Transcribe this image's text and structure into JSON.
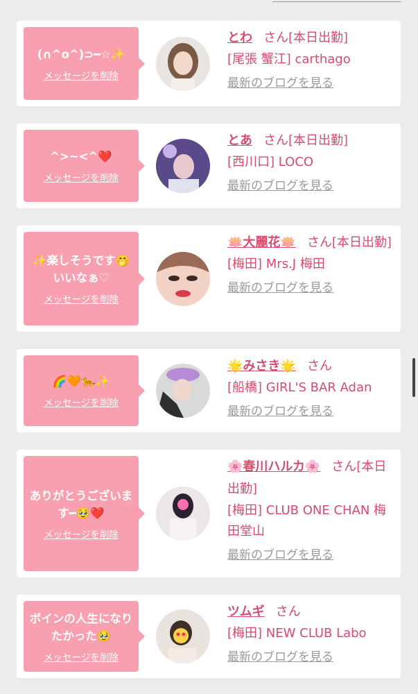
{
  "header": {
    "left_text": "",
    "right_link": ""
  },
  "cards": [
    {
      "message": "(∩^o^)⊃━☆✨",
      "delete_label": "メッセージを削除",
      "name": "とわ",
      "honorific": "さん",
      "status": "[本日出勤]",
      "shop": "[尾張 蟹江] carthago",
      "blog_link": "最新のブログを見る"
    },
    {
      "message": "^>~<^❤️",
      "delete_label": "メッセージを削除",
      "name": "とあ",
      "honorific": "さん",
      "status": "[本日出勤]",
      "shop": "[西川口] LOCO",
      "blog_link": "最新のブログを見る"
    },
    {
      "message": "✨楽しそうです🤭いいなぁ♡",
      "delete_label": "メッセージを削除",
      "name": "🪷大麗花🪷",
      "honorific": "さん",
      "status": "[本日出勤]",
      "shop": "[梅田] Mrs.J 梅田",
      "blog_link": "最新のブログを見る"
    },
    {
      "message": "🌈🧡🐆✨",
      "delete_label": "メッセージを削除",
      "name": "🌟みさき🌟",
      "honorific": "さん",
      "status": "",
      "shop": "[船橋] GIRL'S BAR Adan",
      "blog_link": "最新のブログを見る"
    },
    {
      "message": "ありがとうございます━🥹❤️",
      "delete_label": "メッセージを削除",
      "name": "🌸春川ハルカ🌸",
      "honorific": "さん",
      "status": "[本日出勤]",
      "shop": "[梅田] CLUB ONE CHAN 梅田堂山",
      "blog_link": "最新のブログを見る"
    },
    {
      "message": "ボインの人生になりたかった🥹",
      "delete_label": "メッセージを削除",
      "name": "ツムギ",
      "honorific": "さん",
      "status": "",
      "shop": "[梅田] NEW CLUB Labo",
      "blog_link": "最新のブログを見る"
    }
  ],
  "colors": {
    "bubble": "#f8a0b0",
    "accent": "#d64c6d",
    "link_gray": "#9a9a9a"
  }
}
